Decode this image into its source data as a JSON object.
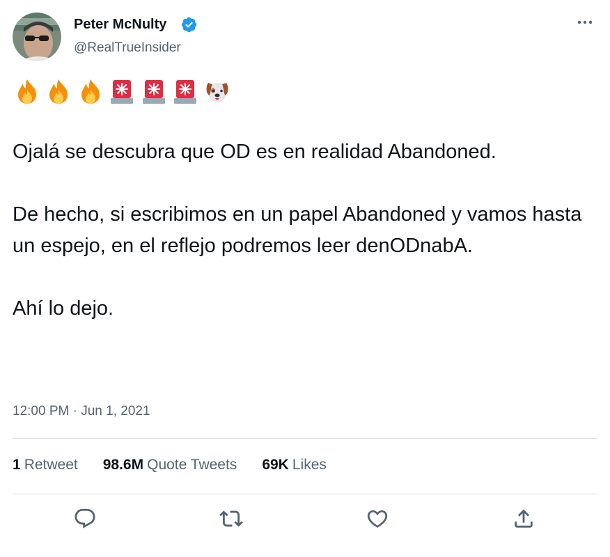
{
  "author": {
    "display_name": "Peter McNulty",
    "handle": "@RealTrueInsider",
    "verified": true
  },
  "tweet": {
    "emojis": [
      "fire",
      "fire",
      "fire",
      "police-light",
      "police-light",
      "police-light",
      "dog-face"
    ],
    "paragraphs": [
      "Ojalá se descubra que OD es en realidad Abandoned.",
      "De hecho, si escribimos en un papel Abandoned y vamos hasta un espejo, en el reflejo podremos leer denODnabA.",
      "Ahí lo dejo."
    ],
    "timestamp": "12:00 PM · Jun 1, 2021"
  },
  "stats": {
    "retweets_count": "1",
    "retweets_label": "Retweet",
    "quotes_count": "98.6M",
    "quotes_label": "Quote Tweets",
    "likes_count": "69K",
    "likes_label": "Likes"
  },
  "actions": [
    "reply-icon",
    "retweet-icon",
    "like-icon",
    "share-icon"
  ],
  "colors": {
    "text": "#0f1419",
    "secondary": "#536471",
    "divider": "#cfd9de",
    "verified": "#1d9bf0"
  }
}
